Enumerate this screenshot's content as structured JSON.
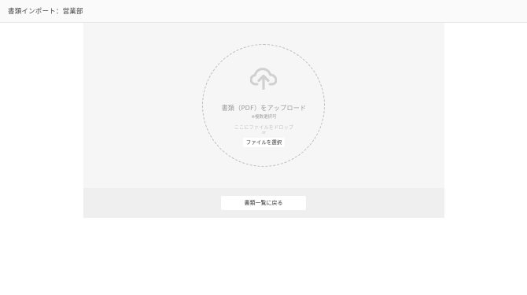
{
  "header": {
    "title": "書類インポート：営業部"
  },
  "upload": {
    "icon": "cloud-upload-icon",
    "title": "書類（PDF）をアップロード",
    "note": "※複数選択可",
    "drop_hint": "ここにファイルをドロップ",
    "or_text": "or",
    "select_button_label": "ファイルを選択"
  },
  "footer": {
    "back_button_label": "書類一覧に戻る"
  },
  "colors": {
    "panel_background": "#f6f6f6",
    "footer_background": "#efefef",
    "icon_color": "#d0d0d0"
  }
}
